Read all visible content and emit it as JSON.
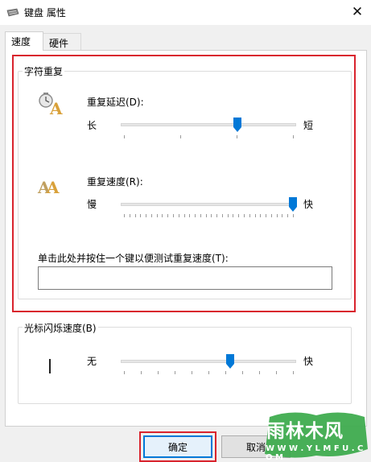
{
  "window": {
    "title": "键盘 属性",
    "close_glyph": "✕"
  },
  "tabs": [
    {
      "label": "速度",
      "active": true
    },
    {
      "label": "硬件",
      "active": false
    }
  ],
  "repeat_group": {
    "title": "字符重复",
    "delay": {
      "label": "重复延迟(D):",
      "min_label": "长",
      "max_label": "短",
      "value_fraction": 0.67,
      "tick_count": 4
    },
    "rate": {
      "label": "重复速度(R):",
      "min_label": "慢",
      "max_label": "快",
      "value_fraction": 1.0,
      "tick_count": 32
    },
    "test": {
      "label": "单击此处并按住一个键以便测试重复速度(T):",
      "value": ""
    }
  },
  "blink_group": {
    "title": "光标闪烁速度(B)",
    "min_label": "无",
    "max_label": "快",
    "value_fraction": 0.63,
    "tick_count": 11
  },
  "buttons": {
    "ok": "确定",
    "cancel": "取消"
  },
  "watermark": {
    "text": "雨林木风",
    "url": "W W W . Y L M F U . C O M"
  },
  "colors": {
    "highlight_red": "#d9232d",
    "slider_blue": "#0078d7",
    "watermark_green": "#3aa94a"
  }
}
